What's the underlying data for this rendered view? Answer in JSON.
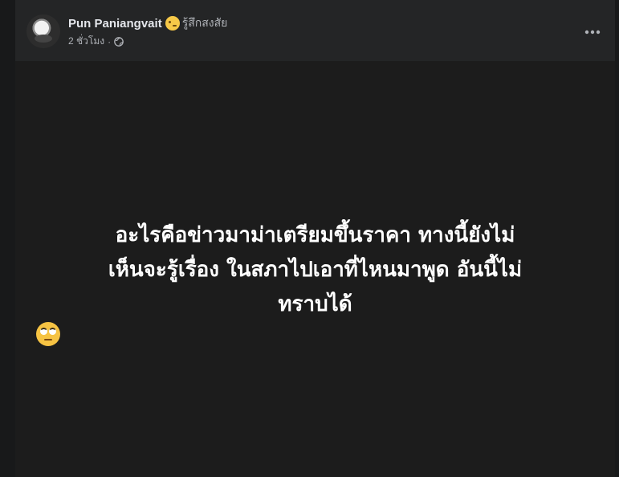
{
  "post": {
    "author": "Pun Paniangvait",
    "feeling_label": "รู้สึกสงสัย",
    "feeling_icon": "thinking-face-icon",
    "timestamp": "2 ชั่วโมง",
    "separator": "·",
    "privacy_icon": "globe-icon",
    "more_icon": "more-horizontal-icon",
    "status_lines": [
      "อะไรคือข่าวมาม่าเตรียมขึ้นราคา ทางนี้ยังไม่",
      "เห็นจะรู้เรื่อง ในสภาไปเอาที่ไหนมาพูด อันนี้ไม่",
      "ทราบได้"
    ],
    "status_end_icon": "face-with-rolling-eyes-icon"
  },
  "colors": {
    "header_background": "#242526",
    "status_background": "#1c1c1c",
    "text_primary": "#e4e6eb",
    "text_secondary": "#b0b3b8",
    "status_text": "#ffffff"
  }
}
